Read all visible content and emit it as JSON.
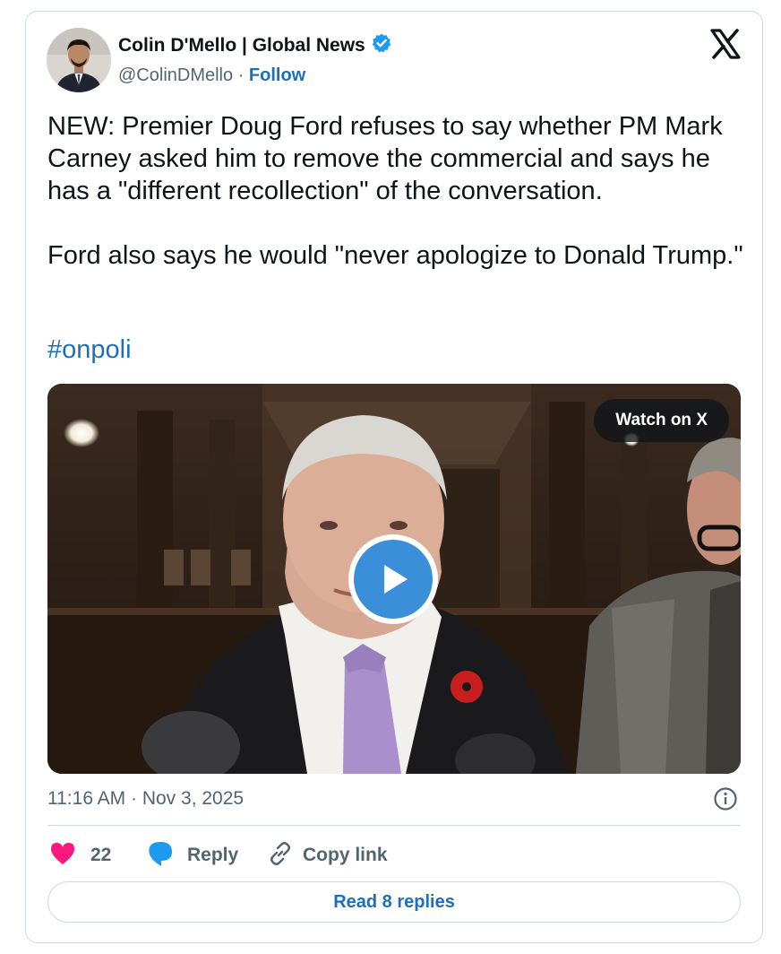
{
  "author": {
    "name": "Colin D'Mello | Global News",
    "handle": "@ColinDMello",
    "separator": "·",
    "follow_label": "Follow",
    "verified_color": "#1d9bf0"
  },
  "tweet": {
    "text": "NEW: Premier Doug Ford refuses to say whether PM Mark Carney asked him to remove the commercial and says he has a \"different recollection\" of the conversation.\n\nFord also says he would \"never apologize to Donald Trump.\"",
    "hashtag": "#onpoli",
    "timestamp": "11:16 AM · Nov 3, 2025"
  },
  "video": {
    "watch_label": "Watch on X"
  },
  "actions": {
    "like_count": "22",
    "reply_label": "Reply",
    "copy_label": "Copy link",
    "read_replies_label": "Read 8 replies"
  },
  "colors": {
    "accent": "#1d6fbd",
    "like": "#f91880",
    "reply": "#1d9bf0",
    "play": "#3a8fd8"
  }
}
